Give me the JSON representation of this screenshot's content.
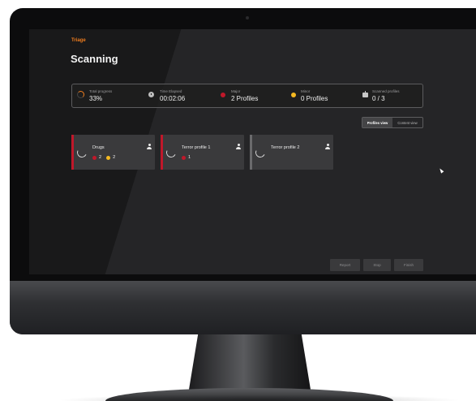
{
  "app": {
    "section": "Triage",
    "title": "Scanning"
  },
  "stats": {
    "total_progress": {
      "label": "Total progress",
      "value": "33%",
      "icon": "progress-ring-icon",
      "fraction": 0.33
    },
    "time_elapsed": {
      "label": "Time Elapsed",
      "value": "00:02:06",
      "icon": "clock-icon"
    },
    "major": {
      "label": "Major",
      "value": "2 Profiles",
      "icon": "major-dot-icon"
    },
    "minor": {
      "label": "Minor",
      "value": "0 Profiles",
      "icon": "minor-dot-icon"
    },
    "scanned_profiles": {
      "label": "Scanned profiles",
      "value": "0 / 3",
      "icon": "robot-icon"
    }
  },
  "view_toggle": {
    "options": [
      "Profiles view",
      "Content view"
    ],
    "selected": "Profiles view"
  },
  "profiles": [
    {
      "name": "Drugs",
      "major_count": "2",
      "minor_count": "2",
      "stripe": "red"
    },
    {
      "name": "Terror profile 1",
      "major_count": "1",
      "stripe": "red"
    },
    {
      "name": "Terror profile 2",
      "stripe": "gray"
    }
  ],
  "actions": {
    "report": "Report",
    "stop": "Stop",
    "finish": "Finish"
  },
  "colors": {
    "accent": "#f07d1e",
    "major": "#c0182a",
    "minor": "#f5b921",
    "screen_bg": "#252527",
    "card_bg": "#3a3a3c",
    "stripe_neutral": "#6a6a6c"
  }
}
